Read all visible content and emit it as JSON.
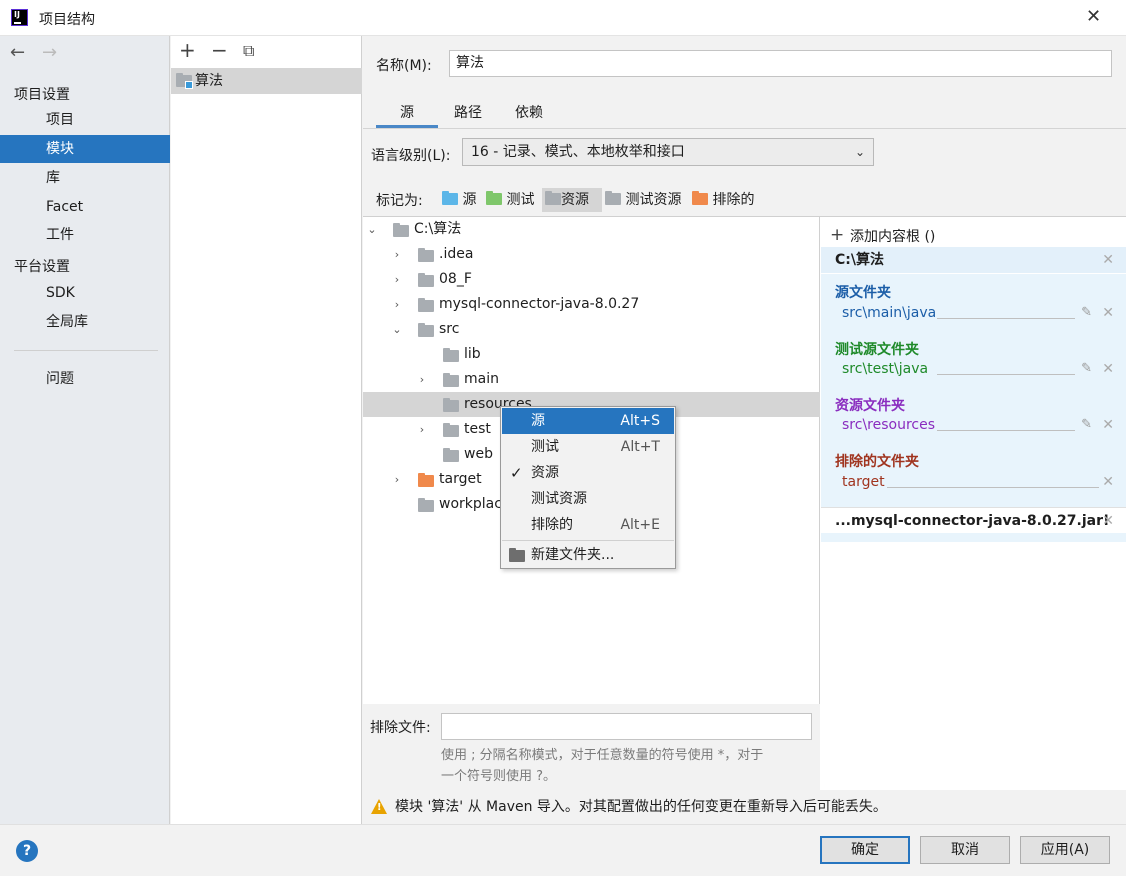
{
  "window": {
    "title": "项目结构",
    "close": "✕"
  },
  "nav": {
    "back": "←",
    "forward": "→",
    "section_project": "项目设置",
    "items_project": [
      "项目",
      "模块",
      "库",
      "Facet",
      "工件"
    ],
    "section_platform": "平台设置",
    "items_platform": [
      "SDK",
      "全局库"
    ],
    "problems": "问题"
  },
  "modules": {
    "add": "+",
    "remove": "−",
    "copy": "⧉",
    "items": [
      "算法"
    ]
  },
  "form": {
    "name_label": "名称(M):",
    "name_value": "算法"
  },
  "tabs": [
    "源",
    "路径",
    "依赖"
  ],
  "language": {
    "label": "语言级别(L):",
    "value": "16 - 记录、模式、本地枚举和接口"
  },
  "mark_as": {
    "label": "标记为:",
    "buttons": [
      "源",
      "测试",
      "资源",
      "测试资源",
      "排除的"
    ]
  },
  "tree": {
    "root": "C:\\算法",
    "items": [
      ".idea",
      "08_F",
      "mysql-connector-java-8.0.27",
      "src",
      "lib",
      "main",
      "resources",
      "test",
      "web",
      "target",
      "workplace"
    ]
  },
  "context_menu": {
    "items": [
      {
        "label": "源",
        "shortcut": "Alt+S"
      },
      {
        "label": "测试",
        "shortcut": "Alt+T"
      },
      {
        "label": "资源",
        "shortcut": ""
      },
      {
        "label": "测试资源",
        "shortcut": ""
      },
      {
        "label": "排除的",
        "shortcut": "Alt+E"
      }
    ],
    "new_folder": "新建文件夹...",
    "check": "✓"
  },
  "content_roots": {
    "add_label": "添加内容根 ()",
    "root1": "C:\\算法",
    "sources_title": "源文件夹",
    "sources_path": "src\\main\\java",
    "tests_title": "测试源文件夹",
    "tests_path": "src\\test\\java",
    "resources_title": "资源文件夹",
    "resources_path": "src\\resources",
    "excluded_title": "排除的文件夹",
    "excluded_path": "target",
    "root2": "...mysql-connector-java-8.0.27.jar!"
  },
  "exclude": {
    "label": "排除文件:",
    "value": "",
    "hint1": "使用 ; 分隔名称模式，对于任意数量的符号使用 *，对于",
    "hint2": "一个符号则使用 ?。"
  },
  "warning": "模块 '算法' 从 Maven 导入。对其配置做出的任何变更在重新导入后可能丢失。",
  "buttons": {
    "help": "?",
    "ok": "确定",
    "cancel": "取消",
    "apply": "应用(A)"
  },
  "colors": {
    "accent": "#2675bf",
    "source": "#1c5ea8",
    "test": "#1f8a2a",
    "resource": "#8a2dbf",
    "excluded": "#a0341f"
  }
}
